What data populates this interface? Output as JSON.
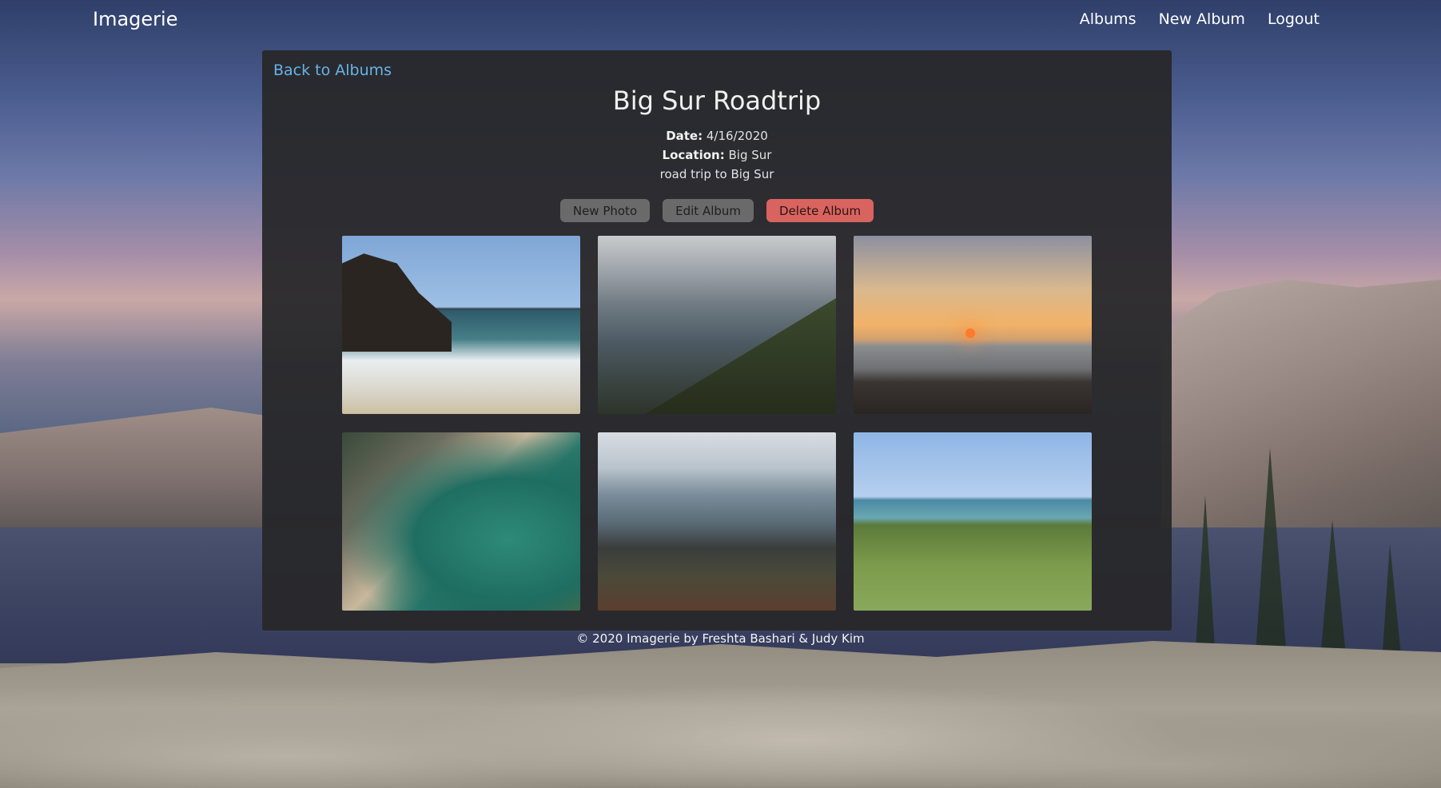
{
  "nav": {
    "brand": "Imagerie",
    "links": [
      "Albums",
      "New Album",
      "Logout"
    ]
  },
  "album": {
    "back_link": "Back to Albums",
    "title": "Big Sur Roadtrip",
    "date_label": "Date:",
    "date": "4/16/2020",
    "location_label": "Location:",
    "location": "Big Sur",
    "description": "road trip to Big Sur",
    "actions": {
      "new_photo": "New Photo",
      "edit_album": "Edit Album",
      "delete_album": "Delete Album"
    },
    "photo_count": 6
  },
  "footer": {
    "text": "© 2020 Imagerie by Freshta Bashari & Judy Kim"
  },
  "colors": {
    "link": "#67b3e6",
    "card_bg": "#28282a",
    "button_gray": "#6a6a6a",
    "button_red": "#d9645f"
  }
}
